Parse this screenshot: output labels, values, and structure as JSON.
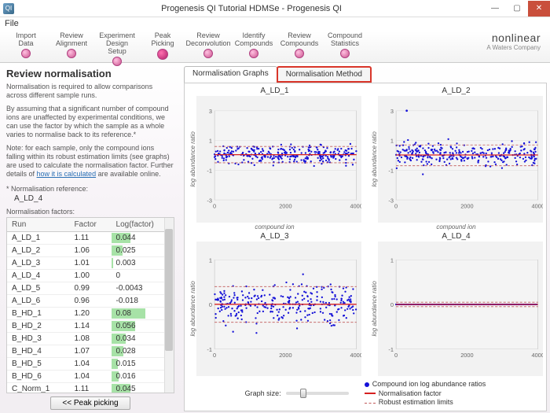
{
  "window": {
    "title": "Progenesis QI Tutorial HDMSe - Progenesis QI",
    "icon_text": "QI"
  },
  "menu": {
    "file": "File"
  },
  "pipeline": {
    "steps": [
      {
        "label": "Import Data"
      },
      {
        "label": "Review Alignment"
      },
      {
        "label": "Experiment Design Setup"
      },
      {
        "label": "Peak Picking",
        "active": true
      },
      {
        "label": "Review Deconvolution"
      },
      {
        "label": "Identify Compounds"
      },
      {
        "label": "Review Compounds"
      },
      {
        "label": "Compound Statistics"
      }
    ]
  },
  "logo": {
    "brand": "nonlinear",
    "tagline": "A Waters Company"
  },
  "left": {
    "heading": "Review normalisation",
    "para1": "Normalisation is required to allow comparisons across different sample runs.",
    "para2a": "By assuming that a significant number of compound ions are unaffected by experimental conditions, we can use the factor by which the sample as a whole varies to normalise back to its reference.",
    "para2b": "*",
    "para3a": "Note: for each sample, only the compound ions falling within its robust estimation limits (see graphs) are used to calculate the normalisation factor. Further details of ",
    "para3link": "how it is calculated",
    "para3b": " are available online.",
    "ref_label": "* Normalisation reference:",
    "ref_value": "A_LD_4",
    "factors_label": "Normalisation factors:",
    "table": {
      "headers": [
        "Run",
        "Factor",
        "Log(factor)"
      ],
      "rows": [
        {
          "run": "A_LD_1",
          "factor": "1.11",
          "logf": "0.044",
          "bar": 55
        },
        {
          "run": "A_LD_2",
          "factor": "1.06",
          "logf": "0.025",
          "bar": 32
        },
        {
          "run": "A_LD_3",
          "factor": "1.01",
          "logf": "0.003",
          "bar": 6
        },
        {
          "run": "A_LD_4",
          "factor": "1.00",
          "logf": "0",
          "bar": 0
        },
        {
          "run": "A_LD_5",
          "factor": "0.99",
          "logf": "-0.0043",
          "bar": 0
        },
        {
          "run": "A_LD_6",
          "factor": "0.96",
          "logf": "-0.018",
          "bar": 0
        },
        {
          "run": "B_HD_1",
          "factor": "1.20",
          "logf": "0.08",
          "bar": 100
        },
        {
          "run": "B_HD_2",
          "factor": "1.14",
          "logf": "0.056",
          "bar": 70
        },
        {
          "run": "B_HD_3",
          "factor": "1.08",
          "logf": "0.034",
          "bar": 43
        },
        {
          "run": "B_HD_4",
          "factor": "1.07",
          "logf": "0.028",
          "bar": 36
        },
        {
          "run": "B_HD_5",
          "factor": "1.04",
          "logf": "0.015",
          "bar": 20
        },
        {
          "run": "B_HD_6",
          "factor": "1.04",
          "logf": "0.016",
          "bar": 21
        },
        {
          "run": "C_Norm_1",
          "factor": "1.11",
          "logf": "0.045",
          "bar": 56
        }
      ]
    },
    "back_btn": "<< Peak picking"
  },
  "right": {
    "tabs": [
      {
        "label": "Normalisation Graphs",
        "active": true
      },
      {
        "label": "Normalisation Method",
        "highlight": true
      }
    ],
    "graph_size_label": "Graph size:",
    "axis_x": "compound ion",
    "axis_y": "log abundance ratio",
    "legend": {
      "l1": "Compound ion log abundance ratios",
      "l2": "Normalisation factor",
      "l3": "Robust estimation limits"
    },
    "colors": {
      "point": "#1410d8",
      "norm_line": "#d62020",
      "robust_line": "#c05858"
    }
  },
  "chart_data": [
    {
      "type": "scatter",
      "title": "A_LD_1",
      "xlabel": "compound ion",
      "ylabel": "log abundance ratio",
      "xlim": [
        0,
        4000
      ],
      "ylim": [
        -3,
        3
      ],
      "xticks": [
        0,
        2000,
        4000
      ],
      "yticks": [
        -3,
        -1,
        1,
        3
      ],
      "norm_factor": 0.044,
      "robust": [
        -0.5,
        0.6
      ],
      "n_points": 4200,
      "spread": 0.45,
      "outlier_y": null
    },
    {
      "type": "scatter",
      "title": "A_LD_2",
      "xlabel": "compound ion",
      "ylabel": "log abundance ratio",
      "xlim": [
        0,
        4000
      ],
      "ylim": [
        -3,
        3
      ],
      "xticks": [
        0,
        2000,
        4000
      ],
      "yticks": [
        -3,
        -1,
        1,
        3
      ],
      "norm_factor": 0.025,
      "robust": [
        -0.7,
        0.7
      ],
      "n_points": 4200,
      "spread": 0.55,
      "outlier_y": 3
    },
    {
      "type": "scatter",
      "title": "A_LD_3",
      "xlabel": "compound ion",
      "ylabel": "",
      "xlim": [
        0,
        4000
      ],
      "ylim": [
        -1,
        1
      ],
      "xticks": [
        0,
        2000,
        4000
      ],
      "yticks": [
        -1,
        0,
        1
      ],
      "norm_factor": 0.003,
      "robust": [
        -0.4,
        0.4
      ],
      "n_points": 4200,
      "spread": 0.35,
      "outlier_y": null
    },
    {
      "type": "scatter",
      "title": "A_LD_4",
      "xlabel": "compound ion",
      "ylabel": "",
      "xlim": [
        0,
        4000
      ],
      "ylim": [
        -1,
        1
      ],
      "xticks": [
        0,
        2000,
        4000
      ],
      "yticks": [
        -1,
        0,
        1
      ],
      "norm_factor": 0,
      "robust": [
        -0.05,
        0.05
      ],
      "n_points": 4200,
      "spread": 0.0,
      "outlier_y": null
    }
  ]
}
